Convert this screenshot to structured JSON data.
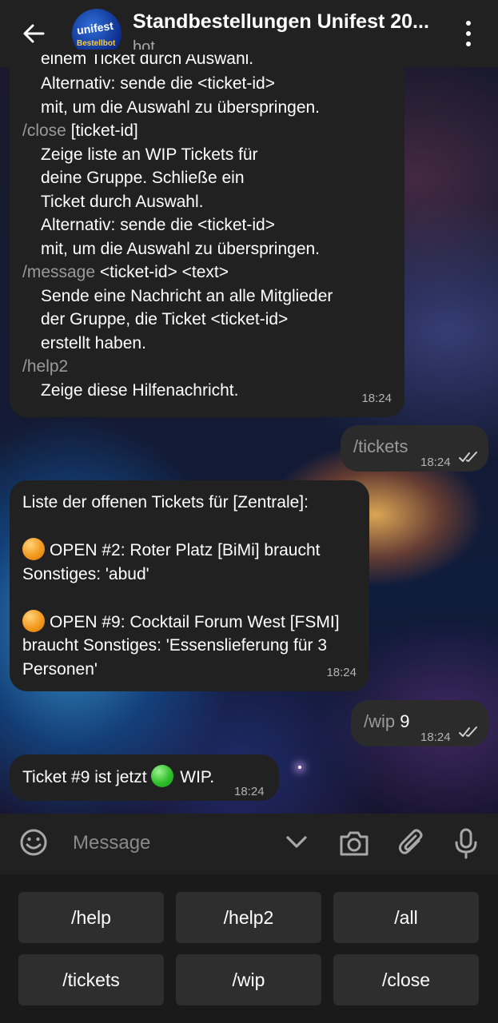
{
  "header": {
    "title": "Standbestellungen Unifest 20...",
    "subtitle": "bot",
    "avatar_text_top": "unifest",
    "avatar_text_bottom": "Bestellbot"
  },
  "messages": {
    "help": {
      "line_partial": "einem Ticket durch Auswahl.",
      "line_1": "Alternativ: sende die <ticket-id>",
      "line_2": "mit, um die Auswahl zu überspringen.",
      "close_cmd": "/close",
      "close_arg": " [ticket-id]",
      "close_1": "Zeige liste an WIP Tickets für",
      "close_2": "deine Gruppe. Schließe ein",
      "close_3": "Ticket durch Auswahl.",
      "close_4": "Alternativ: sende die <ticket-id>",
      "close_5": "mit, um die Auswahl zu überspringen.",
      "message_cmd": "/message",
      "message_arg": " <ticket-id> <text>",
      "message_1": "Sende eine Nachricht an alle Mitglieder",
      "message_2": "der Gruppe, die Ticket <ticket-id>",
      "message_3": "erstellt haben.",
      "help2_cmd": "/help2",
      "help2_1": "Zeige diese Hilfenachricht.",
      "time": "18:24"
    },
    "tickets_cmd": {
      "text": "/tickets",
      "time": "18:24"
    },
    "ticket_list": {
      "heading": "Liste der offenen Tickets für [Zentrale]:",
      "ticket1_line1": "OPEN #2: Roter Platz [BiMi] braucht",
      "ticket1_line2": "Sonstiges: 'abud'",
      "ticket2_line1": "OPEN #9: Cocktail Forum West [FSMI]",
      "ticket2_line2": "braucht Sonstiges: 'Essenslieferung für 3",
      "ticket2_line3": "Personen'",
      "time": "18:24"
    },
    "wip_cmd": {
      "cmd": "/wip",
      "arg": " 9",
      "time": "18:24"
    },
    "wip_reply": {
      "text_before": "Ticket #9 ist jetzt ",
      "text_after": " WIP.",
      "time": "18:24"
    }
  },
  "input": {
    "placeholder": "Message"
  },
  "keyboard": {
    "buttons": [
      "/help",
      "/help2",
      "/all",
      "/tickets",
      "/wip",
      "/close"
    ]
  },
  "icons": {
    "back": "arrow-left-icon",
    "menu": "more-vertical-icon",
    "emoji": "emoji-icon",
    "collapse": "chevron-down-icon",
    "camera": "camera-icon",
    "attach": "paperclip-icon",
    "mic": "microphone-icon",
    "ticks": "double-check-icon"
  },
  "colors": {
    "header_bg": "#212121",
    "bubble_in": "#212121",
    "bubble_out": "#2b2b2b",
    "command_grey": "#9a9a9a",
    "open_dot": "#f29a1e",
    "wip_dot": "#2fbf2c"
  }
}
